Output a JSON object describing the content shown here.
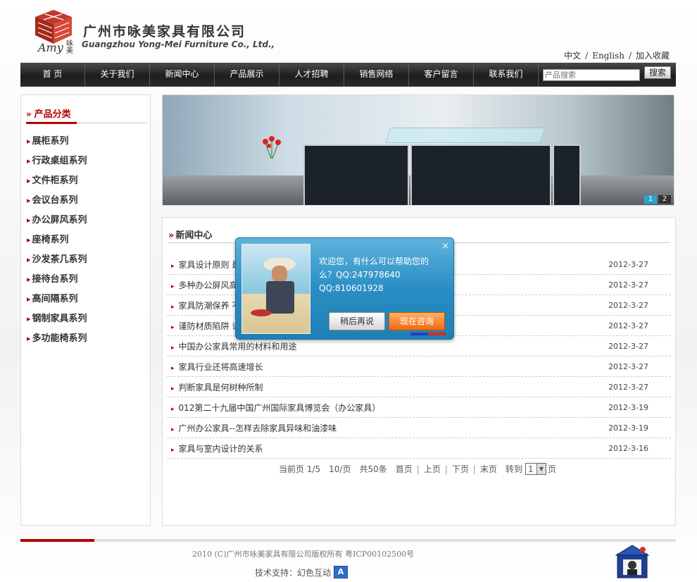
{
  "header": {
    "logo_amy": "Amy",
    "logo_cn": "咏美",
    "company_cn": "广州市咏美家具有限公司",
    "company_en": "Guangzhou Yong-Mei Furniture Co., Ltd.,",
    "lang_cn": "中文",
    "lang_en": "English",
    "add_fav": "加入收藏",
    "sep": "/"
  },
  "nav": {
    "items": [
      "首 页",
      "关于我们",
      "新闻中心",
      "产品展示",
      "人才招聘",
      "销售网络",
      "客户留言",
      "联系我们"
    ],
    "search_placeholder": "产品搜索",
    "search_button": "搜索"
  },
  "sidebar": {
    "title": "产品分类",
    "items": [
      "展柜系列",
      "行政桌组系列",
      "文件柜系列",
      "会议台系列",
      "办公屏风系列",
      "座椅系列",
      "沙发茶几系列",
      "接待台系列",
      "高间隔系列",
      "钢制家具系列",
      "多功能椅系列"
    ]
  },
  "banner": {
    "pages": [
      "1",
      "2"
    ]
  },
  "news": {
    "title": "新闻中心",
    "rows": [
      {
        "title": "家具设计原则 最",
        "date": "2012-3-27"
      },
      {
        "title": "多种办公屏风高",
        "date": "2012-3-27"
      },
      {
        "title": "家具防潮保养 不",
        "date": "2012-3-27"
      },
      {
        "title": "谨防材质陷阱 请",
        "date": "2012-3-27"
      },
      {
        "title": "中国办公家具常用的材料和用途",
        "date": "2012-3-27"
      },
      {
        "title": "家具行业还将高速增长",
        "date": "2012-3-27"
      },
      {
        "title": "判断家具是何树种所制",
        "date": "2012-3-27"
      },
      {
        "title": "012第二十九届中国广州国际家具博览会（办公家具）",
        "date": "2012-3-19"
      },
      {
        "title": "广州办公家具--怎样去除家具异味和油漆味",
        "date": "2012-3-19"
      },
      {
        "title": "家具与室内设计的关系",
        "date": "2012-3-16"
      }
    ],
    "pagination": {
      "current": "当前页 1/5",
      "per_page": "10/页",
      "total": "共50条",
      "first": "首页",
      "prev": "上页",
      "next": "下页",
      "last": "末页",
      "goto": "转到",
      "page_value": "1",
      "page_suffix": "页"
    }
  },
  "chat": {
    "message_line1": "欢迎您，有什么可以帮助您的么？QQ:247978640",
    "message_line2": "QQ:810601928",
    "later_button": "稍后再说",
    "now_button": "现在咨询",
    "close": "×"
  },
  "footer": {
    "copyright": "2010 (C)广州市咏美家具有限公司版权所有 粤ICP00102500号",
    "tech_support": "技术支持：幻色互动",
    "tech_icon": "A"
  },
  "colors": {
    "accent_red": "#b30000",
    "nav_dark": "#1d1d1d",
    "chat_blue": "#2a8ec4",
    "chat_orange": "#f06a10"
  }
}
